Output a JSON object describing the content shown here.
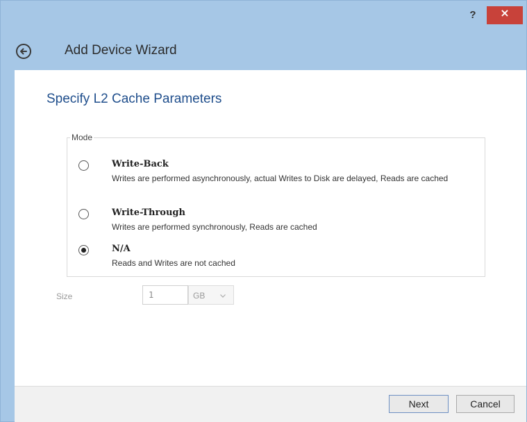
{
  "window": {
    "help_label": "?",
    "close_label": "×"
  },
  "header": {
    "title": "Add Device Wizard"
  },
  "page": {
    "title": "Specify L2 Cache Parameters"
  },
  "mode": {
    "legend": "Mode",
    "options": [
      {
        "title": "Write-Back",
        "description": "Writes are performed asynchronously, actual Writes to Disk are delayed, Reads are cached",
        "selected": false
      },
      {
        "title": "Write-Through",
        "description": "Writes are performed synchronously, Reads are cached",
        "selected": false
      },
      {
        "title": "N/A",
        "description": "Reads and Writes are not cached",
        "selected": true
      }
    ]
  },
  "size": {
    "label": "Size",
    "value": "1",
    "unit": "GB"
  },
  "footer": {
    "next_label": "Next",
    "cancel_label": "Cancel"
  },
  "colors": {
    "titlebar": "#a6c7e6",
    "close_button": "#c8423a",
    "page_title": "#1f4e8c"
  }
}
